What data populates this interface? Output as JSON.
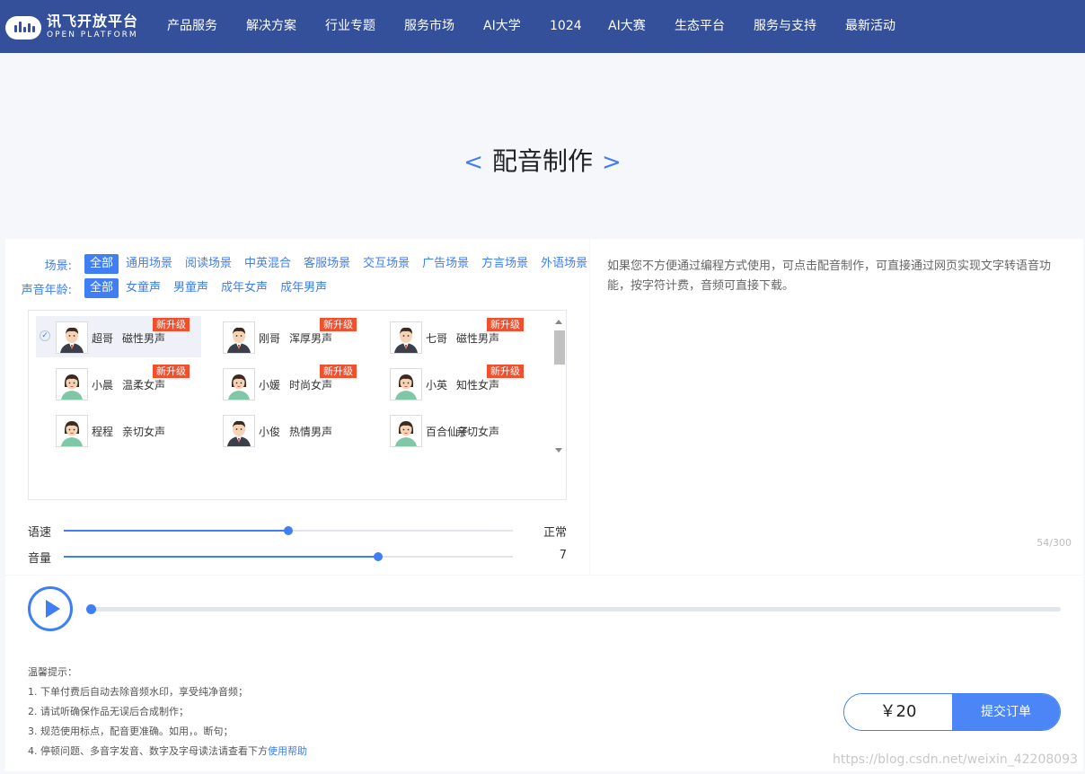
{
  "nav": {
    "logo_cn": "讯飞开放平台",
    "logo_en": "OPEN PLATFORM",
    "items": [
      "产品服务",
      "解决方案",
      "行业专题",
      "服务市场",
      "AI大学",
      "1024",
      "AI大赛",
      "生态平台",
      "服务与支持",
      "最新活动"
    ]
  },
  "hero": {
    "prev": "<",
    "title": "配音制作",
    "next": ">"
  },
  "filters": {
    "scene_label": "场景:",
    "scene_options": [
      "全部",
      "通用场景",
      "阅读场景",
      "中英混合",
      "客服场景",
      "交互场景",
      "广告场景",
      "方言场景",
      "外语场景"
    ],
    "scene_selected": "全部",
    "age_label": "声音年龄:",
    "age_options": [
      "全部",
      "女童声",
      "男童声",
      "成年女声",
      "成年男声"
    ],
    "age_selected": "全部"
  },
  "voices": [
    {
      "name": "超哥",
      "desc": "磁性男声",
      "badge": "新升级",
      "gender": "male",
      "selected": true
    },
    {
      "name": "刚哥",
      "desc": "浑厚男声",
      "badge": "新升级",
      "gender": "male",
      "selected": false
    },
    {
      "name": "七哥",
      "desc": "磁性男声",
      "badge": "新升级",
      "gender": "male",
      "selected": false
    },
    {
      "name": "小晨",
      "desc": "温柔女声",
      "badge": "新升级",
      "gender": "female",
      "selected": false
    },
    {
      "name": "小媛",
      "desc": "时尚女声",
      "badge": "新升级",
      "gender": "female",
      "selected": false
    },
    {
      "name": "小英",
      "desc": "知性女声",
      "badge": "新升级",
      "gender": "female",
      "selected": false
    },
    {
      "name": "程程",
      "desc": "亲切女声",
      "badge": "",
      "gender": "female",
      "selected": false
    },
    {
      "name": "小俊",
      "desc": "热情男声",
      "badge": "",
      "gender": "male",
      "selected": false
    },
    {
      "name": "百合仙子",
      "desc": "亲切女声",
      "badge": "",
      "gender": "female",
      "selected": false
    }
  ],
  "controls": {
    "speed_label": "语速",
    "speed_value": "正常",
    "speed_fraction": 0.5,
    "volume_label": "音量",
    "volume_value": "7",
    "volume_fraction": 0.7
  },
  "editor": {
    "text": "如果您不方便通过编程方式使用，可点击配音制作，可直接通过网页实现文字转语音功能，按字符计费，音频可直接下载。",
    "count": "54/300"
  },
  "player": {
    "progress_fraction": 0
  },
  "tips": {
    "title": "温馨提示：",
    "line1": "1. 下单付费后自动去除音频水印，享受纯净音频；",
    "line2": "2. 请试听确保作品无误后合成制作；",
    "line3": "3. 规范使用标点，配音更准确。如用，。断句；",
    "line4_prefix": "4. 停顿问题、多音字发音、数字及字母读法请查看下方",
    "help_link": "使用帮助"
  },
  "order": {
    "price": "￥20",
    "submit": "提交订单"
  },
  "watermark": "https://blog.csdn.net/weixin_42208093"
}
